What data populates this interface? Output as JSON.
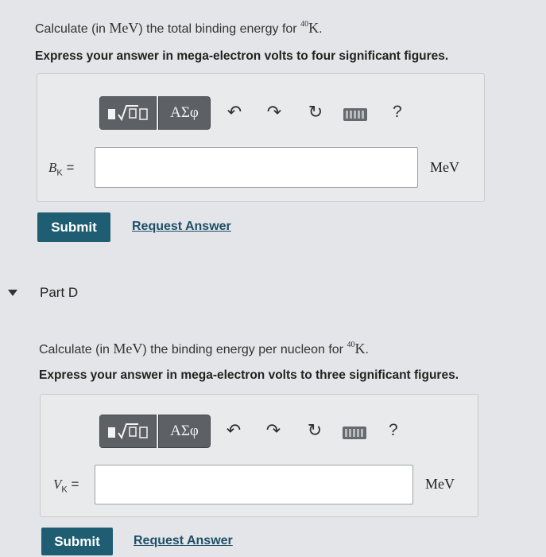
{
  "partC": {
    "question_prefix": "Calculate (in ",
    "question_unit": "MeV",
    "question_mid": ") the total binding energy for ",
    "isotope_mass": "40",
    "isotope_symbol": "K",
    "question_end": ".",
    "instruction": "Express your answer in mega-electron volts to four significant figures.",
    "toolbar": {
      "templates_icon": "sqrt-template-icon",
      "greek_label": "ΑΣφ",
      "undo_icon": "undo-icon",
      "redo_icon": "redo-icon",
      "reset_icon": "reset-icon",
      "keyboard_icon": "keyboard-icon",
      "help_label": "?"
    },
    "var_symbol": "B",
    "var_sub": "K",
    "equals": "=",
    "input_value": "",
    "unit": "MeV",
    "submit_label": "Submit",
    "request_label": "Request Answer"
  },
  "partD": {
    "title": "Part D",
    "question_prefix": "Calculate (in ",
    "question_unit": "MeV",
    "question_mid": ") the binding energy per nucleon for ",
    "isotope_mass": "40",
    "isotope_symbol": "K",
    "question_end": ".",
    "instruction": "Express your answer in mega-electron volts to three significant figures.",
    "toolbar": {
      "greek_label": "ΑΣφ",
      "help_label": "?"
    },
    "var_symbol": "V",
    "var_sub": "K",
    "equals": "=",
    "input_value": "",
    "unit": "MeV",
    "submit_label": "Submit",
    "request_label": "Request Answer"
  }
}
